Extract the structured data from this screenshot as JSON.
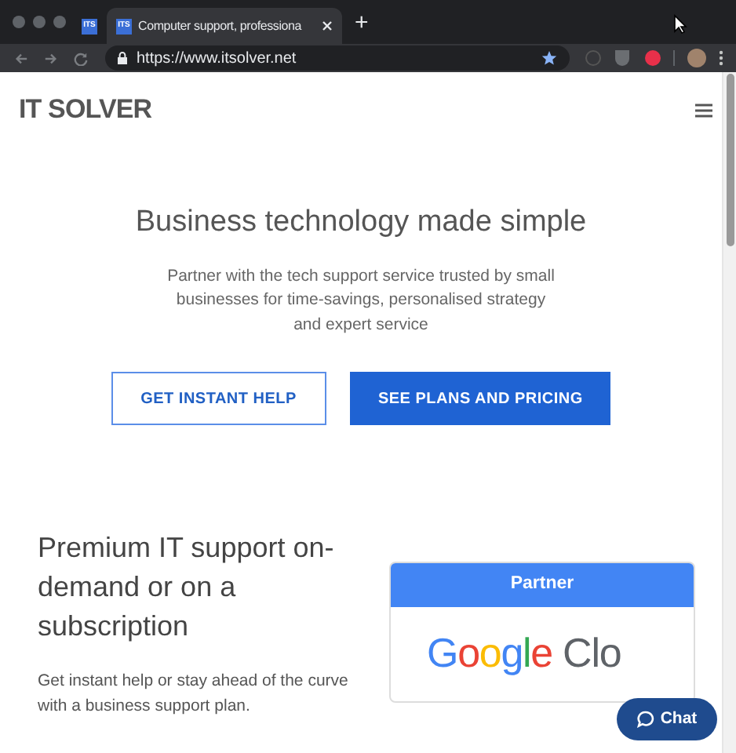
{
  "browser": {
    "tabs": [
      {
        "label": "ITS",
        "selected": false
      },
      {
        "label": "ITS",
        "title": "Computer support, professiona",
        "selected": true
      }
    ],
    "new_tab": "+",
    "url": "https://www.itsolver.net",
    "bookmarked": true
  },
  "header": {
    "logo": "IT SOLVER"
  },
  "hero": {
    "title": "Business technology made simple",
    "text": "Partner with the tech support service trusted by small businesses for time-savings, personalised strategy and expert service",
    "buttons": [
      {
        "label": "GET INSTANT HELP",
        "kind": "outline"
      },
      {
        "label": "SEE PLANS AND PRICING",
        "kind": "solid"
      }
    ]
  },
  "section": {
    "title": "Premium IT support on-demand or on a subscription",
    "text": "Get instant help or stay ahead of the curve with a business support plan."
  },
  "partner_card": {
    "header": "Partner",
    "logo": "Google Clo"
  },
  "chat": {
    "label": "Chat"
  }
}
